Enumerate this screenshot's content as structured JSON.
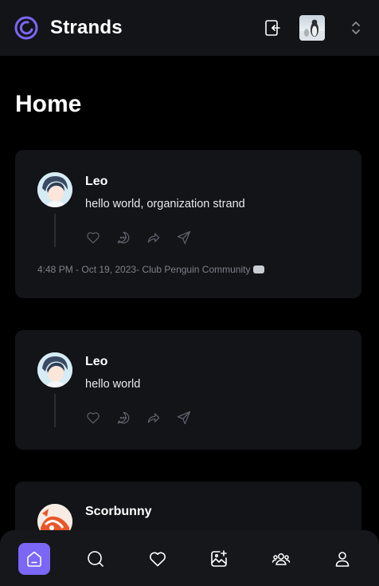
{
  "app": {
    "name": "Strands",
    "accent": "#7a67f5"
  },
  "page": {
    "title": "Home"
  },
  "posts": [
    {
      "author": "Leo",
      "text": "hello world, organization strand",
      "meta": "4:48 PM - Oct 19, 2023- Club Penguin Community"
    },
    {
      "author": "Leo",
      "text": "hello world"
    },
    {
      "author": "Scorbunny"
    }
  ],
  "post_actions": [
    "heart-icon",
    "reply-icon",
    "repost-icon",
    "share-icon"
  ],
  "bottom_nav": [
    {
      "name": "home",
      "active": true
    },
    {
      "name": "search",
      "active": false
    },
    {
      "name": "activity",
      "active": false
    },
    {
      "name": "create-thread",
      "active": false
    },
    {
      "name": "communities",
      "active": false
    },
    {
      "name": "profile",
      "active": false
    }
  ]
}
